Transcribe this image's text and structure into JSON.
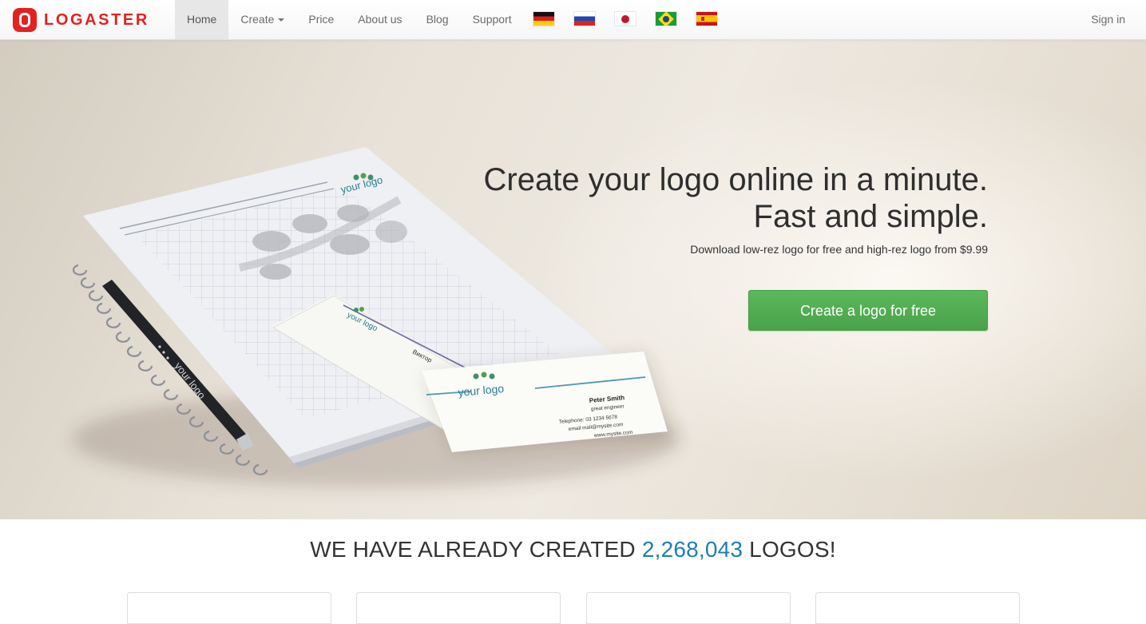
{
  "brand": {
    "name": "LOGASTER",
    "color": "#e3211f"
  },
  "nav": {
    "items": [
      {
        "label": "Home",
        "active": true
      },
      {
        "label": "Create",
        "dropdown": true
      },
      {
        "label": "Price"
      },
      {
        "label": "About us"
      },
      {
        "label": "Blog"
      },
      {
        "label": "Support"
      }
    ],
    "languages": [
      "german-flag-icon",
      "russian-flag-icon",
      "japanese-flag-icon",
      "brazilian-flag-icon",
      "spanish-flag-icon"
    ],
    "signin_label": "Sign in"
  },
  "hero": {
    "title_line1": "Create your logo online in a minute.",
    "title_line2": "Fast and simple.",
    "subtitle": "Download low-rez logo for free and high-rez logo from $9.99",
    "cta_label": "Create a logo for free",
    "cta_color": "#5cb85c",
    "mockup": {
      "notebook_logo": "your logo",
      "pen_logo": "your logo",
      "back_card_logo": "your logo",
      "back_card_name": "Виктор",
      "front_card_logo": "your logo",
      "front_card_name": "Peter Smith",
      "front_card_title": "great engineer",
      "front_card_phone": "Telephone: 03 1234 5678",
      "front_card_email": "email mail@mysite.com",
      "front_card_web": "www.mysite.com"
    }
  },
  "stats": {
    "prefix": "WE HAVE ALREADY CREATED",
    "count": "2,268,043",
    "suffix": "LOGOS!",
    "count_color": "#1e7fae"
  }
}
